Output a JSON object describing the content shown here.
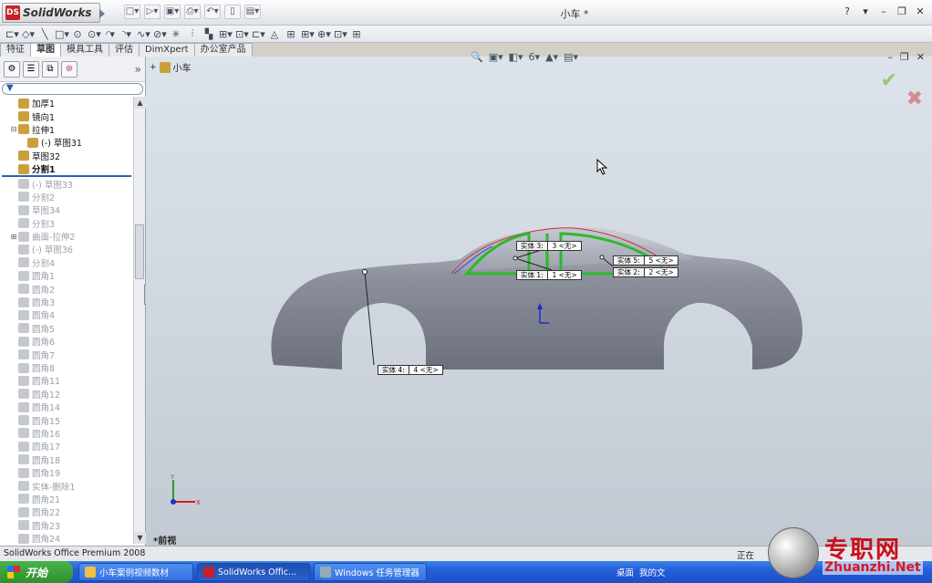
{
  "app": {
    "brand_prefix": "DS",
    "brand_name": "SolidWorks",
    "doc_title": "小车 *"
  },
  "window_controls": [
    "?",
    "▾",
    "–",
    "❐",
    "✕"
  ],
  "quick_access": [
    "□▾",
    "▷▾",
    "▣▾",
    "⎙▾",
    "↶▾",
    "▯",
    "▤▾"
  ],
  "sketch_tools": [
    "⊏▾",
    "◇▾",
    "╲",
    "□▾",
    "⊙",
    "⊙▾",
    "◜▾",
    "◝▾",
    "∿▾",
    "⊘▾",
    "✳",
    "⫶",
    "▚",
    "⊞▾",
    "⊡▾",
    "⊏▾",
    "◬",
    "⊞",
    "⊞▾",
    "⊕▾",
    "⊡▾",
    "⊞"
  ],
  "tabs": [
    "特征",
    "草图",
    "模具工具",
    "评估",
    "DimXpert",
    "办公室产品"
  ],
  "active_tab": 1,
  "filter_icon": "filter-icon",
  "tree": [
    {
      "label": "加厚1",
      "state": "on",
      "exp": ""
    },
    {
      "label": "镜向1",
      "state": "on",
      "exp": ""
    },
    {
      "label": "拉伸1",
      "state": "on",
      "exp": "⊟"
    },
    {
      "label": "(-) 草图31",
      "state": "on",
      "exp": "",
      "indent": 1
    },
    {
      "label": "草图32",
      "state": "on",
      "exp": ""
    },
    {
      "label": "分割1",
      "state": "sel",
      "exp": ""
    },
    {
      "label": "(-) 草图33",
      "state": "off",
      "exp": ""
    },
    {
      "label": "分割2",
      "state": "off",
      "exp": ""
    },
    {
      "label": "草图34",
      "state": "off",
      "exp": ""
    },
    {
      "label": "分割3",
      "state": "off",
      "exp": ""
    },
    {
      "label": "曲面-拉伸2",
      "state": "off",
      "exp": "⊞"
    },
    {
      "label": "(-) 草图36",
      "state": "off",
      "exp": ""
    },
    {
      "label": "分割4",
      "state": "off",
      "exp": ""
    },
    {
      "label": "圆角1",
      "state": "off",
      "exp": ""
    },
    {
      "label": "圆角2",
      "state": "off",
      "exp": ""
    },
    {
      "label": "圆角3",
      "state": "off",
      "exp": ""
    },
    {
      "label": "圆角4",
      "state": "off",
      "exp": ""
    },
    {
      "label": "圆角5",
      "state": "off",
      "exp": ""
    },
    {
      "label": "圆角6",
      "state": "off",
      "exp": ""
    },
    {
      "label": "圆角7",
      "state": "off",
      "exp": ""
    },
    {
      "label": "圆角8",
      "state": "off",
      "exp": ""
    },
    {
      "label": "圆角11",
      "state": "off",
      "exp": ""
    },
    {
      "label": "圆角12",
      "state": "off",
      "exp": ""
    },
    {
      "label": "圆角14",
      "state": "off",
      "exp": ""
    },
    {
      "label": "圆角15",
      "state": "off",
      "exp": ""
    },
    {
      "label": "圆角16",
      "state": "off",
      "exp": ""
    },
    {
      "label": "圆角17",
      "state": "off",
      "exp": ""
    },
    {
      "label": "圆角18",
      "state": "off",
      "exp": ""
    },
    {
      "label": "圆角19",
      "state": "off",
      "exp": ""
    },
    {
      "label": "实体-删除1",
      "state": "off",
      "exp": ""
    },
    {
      "label": "圆角21",
      "state": "off",
      "exp": ""
    },
    {
      "label": "圆角22",
      "state": "off",
      "exp": ""
    },
    {
      "label": "圆角23",
      "state": "off",
      "exp": ""
    },
    {
      "label": "圆角24",
      "state": "off",
      "exp": ""
    }
  ],
  "viewport": {
    "part_name": "小车",
    "view_label": "*前视",
    "view_tools": [
      "🔍",
      "▣▾",
      "◧▾",
      "6▾",
      "▲▾",
      "▤▾"
    ],
    "confirm": "✔",
    "cancel": "✖",
    "bodies": [
      {
        "name": "实体 3:",
        "value": "3 <无>"
      },
      {
        "name": "实体 1:",
        "value": "1 <无>"
      },
      {
        "name": "实体 5:",
        "value": "5 <无>"
      },
      {
        "name": "实体 2:",
        "value": "2 <无>"
      },
      {
        "name": "实体 4:",
        "value": "4 <无>"
      }
    ]
  },
  "status": {
    "left": "SolidWorks Office Premium 2008",
    "right": "正在"
  },
  "taskbar": {
    "start": "开始",
    "buttons": [
      "小车案例视频数材",
      "SolidWorks Offic...",
      "Windows 任务管理器"
    ],
    "tray": [
      "桌面",
      "我的文"
    ]
  },
  "watermark": {
    "cn": "专职网",
    "en": "Zhuanzhi.Net"
  }
}
